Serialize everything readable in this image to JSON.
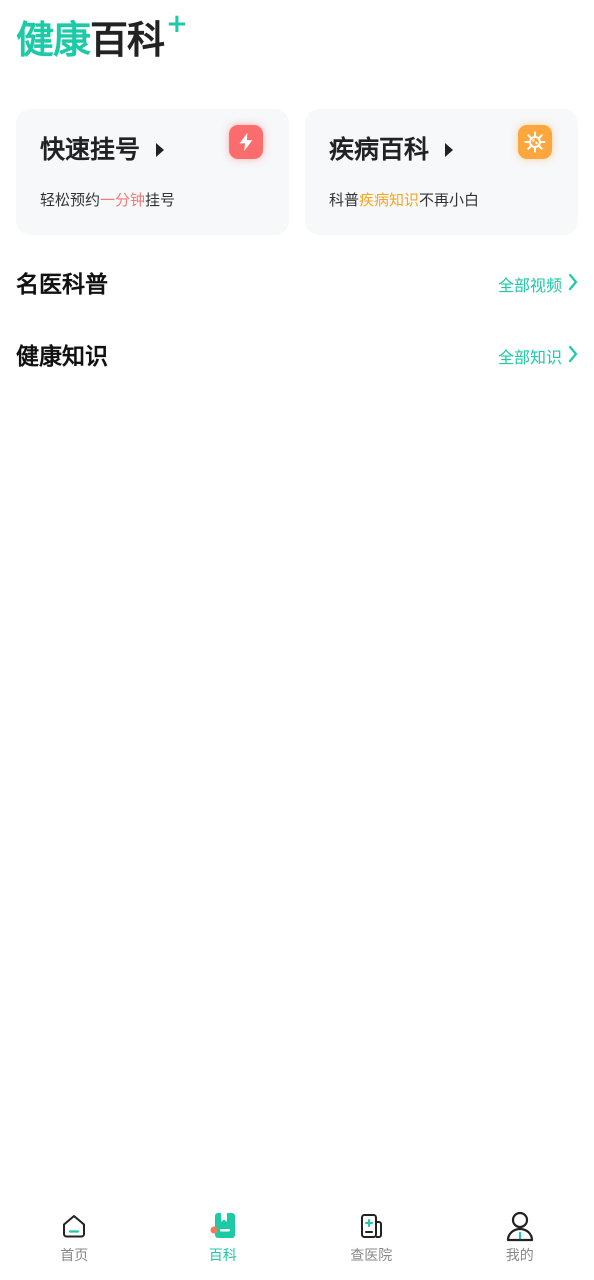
{
  "header": {
    "logo_part1": "健康",
    "logo_part2": "百科",
    "logo_plus": "+"
  },
  "cards": [
    {
      "title": "快速挂号",
      "desc_before": "轻松预约",
      "desc_highlight": "一分钟",
      "desc_after": "挂号",
      "icon": "lightning-icon",
      "color": "#fb6d6d"
    },
    {
      "title": "疾病百科",
      "desc_before": "科普",
      "desc_highlight": "疾病知识",
      "desc_after": "不再小白",
      "icon": "virus-icon",
      "color": "#fba73e"
    }
  ],
  "sections": [
    {
      "title": "名医科普",
      "link": "全部视频"
    },
    {
      "title": "健康知识",
      "link": "全部知识"
    }
  ],
  "bottom_nav": {
    "items": [
      {
        "label": "首页",
        "icon": "home-icon",
        "active": false
      },
      {
        "label": "百科",
        "icon": "encyclopedia-icon",
        "active": true
      },
      {
        "label": "查医院",
        "icon": "hospital-icon",
        "active": false
      },
      {
        "label": "我的",
        "icon": "profile-icon",
        "active": false
      }
    ]
  },
  "colors": {
    "accent": "#1ccaa6",
    "red": "#f07a7a",
    "orange": "#f5a623"
  }
}
